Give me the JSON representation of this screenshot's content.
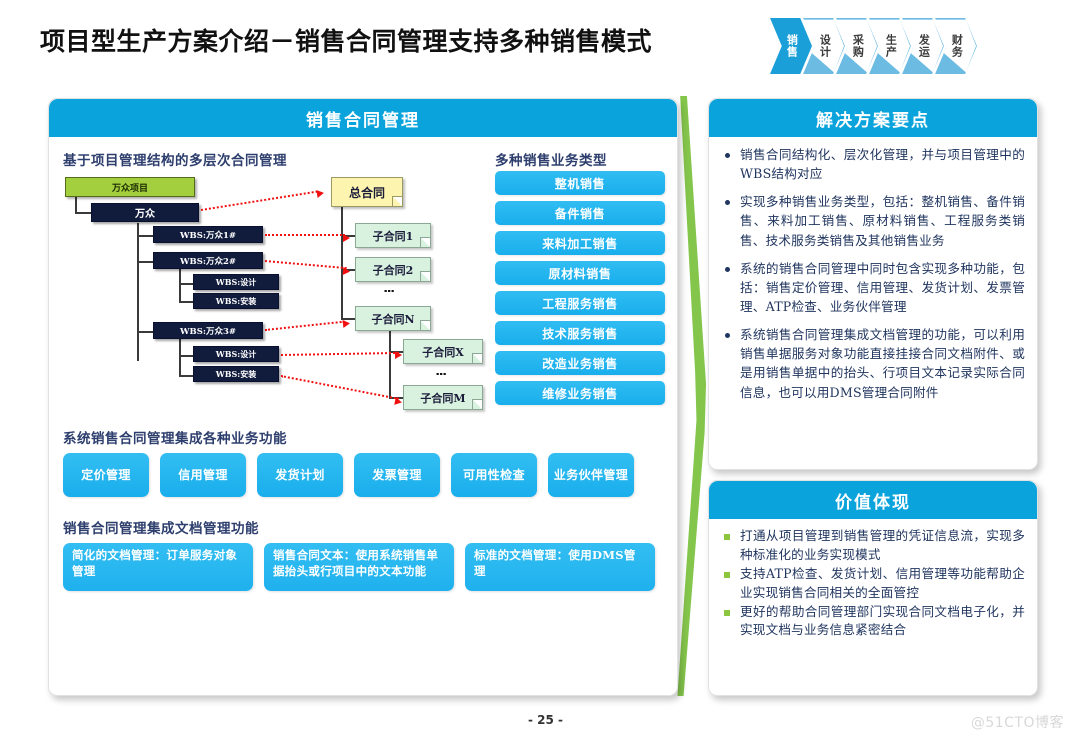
{
  "slide": {
    "title": "项目型生产方案介绍－销售合同管理支持多种销售模式",
    "page_number": "- 25 -",
    "watermark": "@51CTO博客"
  },
  "process_nav": {
    "steps": [
      {
        "label": "销售",
        "active": true
      },
      {
        "label": "设计",
        "active": false
      },
      {
        "label": "采购",
        "active": false
      },
      {
        "label": "生产",
        "active": false
      },
      {
        "label": "发运",
        "active": false
      },
      {
        "label": "财务",
        "active": false
      }
    ]
  },
  "left_panel": {
    "header": "销售合同管理",
    "section_hierarchy_title": "基于项目管理结构的多层次合同管理",
    "section_types_title": "多种销售业务类型",
    "section_functions_title": "系统销售合同管理集成各种业务功能",
    "section_documents_title": "销售合同管理集成文档管理功能",
    "wbs_tree": {
      "project": "万众项目",
      "org": "万众",
      "nodes": [
        "WBS:万众1#",
        "WBS:万众2#",
        "WBS:设计",
        "WBS:安装",
        "WBS:万众3#",
        "WBS:设计",
        "WBS:安装"
      ]
    },
    "contract_tree": {
      "master": "总合同",
      "children": [
        "子合同1",
        "子合同2",
        "子合同N"
      ],
      "grandchildren": [
        "子合同X",
        "子合同M"
      ],
      "ellipsis": "⋮"
    },
    "sales_types": [
      "整机销售",
      "备件销售",
      "来料加工销售",
      "原材料销售",
      "工程服务销售",
      "技术服务销售",
      "改造业务销售",
      "维修业务销售"
    ],
    "business_functions": [
      "定价管理",
      "信用管理",
      "发货计划",
      "发票管理",
      "可用性检查",
      "业务伙伴管理"
    ],
    "document_functions": [
      "简化的文档管理：订单服务对象管理",
      "销售合同文本：使用系统销售单据抬头或行项目中的文本功能",
      "标准的文档管理：使用DMS管理"
    ]
  },
  "solution_panel": {
    "header": "解决方案要点",
    "bullets": [
      "销售合同结构化、层次化管理，并与项目管理中的WBS结构对应",
      "实现多种销售业务类型，包括：整机销售、备件销售、来料加工销售、原材料销售、工程服务类销售、技术服务类销售及其他销售业务",
      "系统的销售合同管理中同时包含实现多种功能，包括：销售定价管理、信用管理、发货计划、发票管理、ATP检查、业务伙伴管理",
      "系统销售合同管理集成文档管理的功能，可以利用销售单据服务对象功能直接挂接合同文档附件、或是用销售单据中的抬头、行项目文本记录实际合同信息，也可以用DMS管理合同附件"
    ]
  },
  "value_panel": {
    "header": "价值体现",
    "bullets": [
      "打通从项目管理到销售管理的凭证信息流，实现多种标准化的业务实现模式",
      "支持ATP检查、发货计划、信用管理等功能帮助企业实现销售合同相关的全面管控",
      "更好的帮助合同管理部门实现合同文档电子化，并实现文档与业务信息紧密结合"
    ]
  },
  "colors": {
    "accent_blue": "#0BA3DC",
    "pill_blue": "#19AEEC",
    "green_leaf": "#7DC242",
    "project_green": "#A3CF3E",
    "node_dark": "#111C3D",
    "contract_yellow": "#FDF5AF",
    "subcontract_green": "#D9F2E0",
    "arrow_red": "#F01010",
    "bullet_square_green": "#8CC63E",
    "text_navy": "#20355F"
  }
}
